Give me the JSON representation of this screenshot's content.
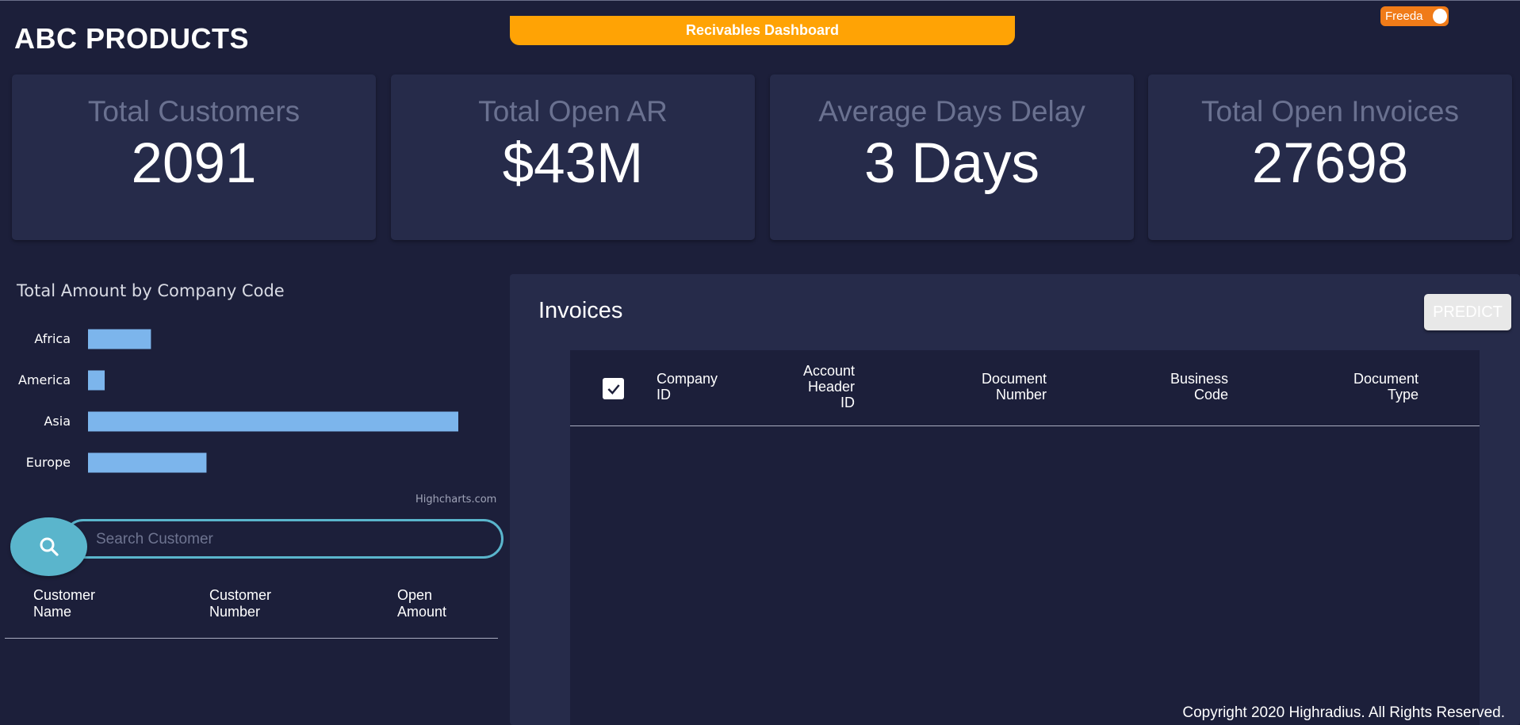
{
  "header": {
    "brand": "ABC PRODUCTS",
    "banner": "Recivables Dashboard",
    "user": "Freeda"
  },
  "kpis": [
    {
      "title": "Total Customers",
      "value": "2091"
    },
    {
      "title": "Total Open AR",
      "value": "$43M"
    },
    {
      "title": "Average Days Delay",
      "value": "3 Days"
    },
    {
      "title": "Total Open Invoices",
      "value": "27698"
    }
  ],
  "chart_data": {
    "type": "bar",
    "orientation": "horizontal",
    "title": "Total Amount by Company Code",
    "categories": [
      "Africa",
      "America",
      "Asia",
      "Europe"
    ],
    "values": [
      17,
      4.5,
      100,
      32
    ],
    "xlim": [
      0,
      100
    ],
    "grid": false,
    "color": "#7cb5ec",
    "credit": "Highcharts.com"
  },
  "search": {
    "placeholder": "Search Customer"
  },
  "customer_table": {
    "headers": [
      [
        "Customer",
        "Name"
      ],
      [
        "Customer",
        "Number"
      ],
      [
        "Open",
        "Amount"
      ]
    ]
  },
  "invoices": {
    "title": "Invoices",
    "predict_label": "PREDICT",
    "headers": [
      [
        "Company",
        "ID"
      ],
      [
        "Account",
        "Header",
        "ID"
      ],
      [
        "Document",
        "Number"
      ],
      [
        "Business",
        "Code"
      ],
      [
        "Document",
        "Type"
      ]
    ]
  },
  "footer": {
    "copyright": "Copyright 2020 Highradius. All Rights Reserved."
  },
  "colors": {
    "background": "#1c1f3a",
    "card": "#262b4a",
    "banner": "#ffa305",
    "accent": "#5ab5cc",
    "bar": "#7cb5ec",
    "user_pill": "#f07b18"
  }
}
